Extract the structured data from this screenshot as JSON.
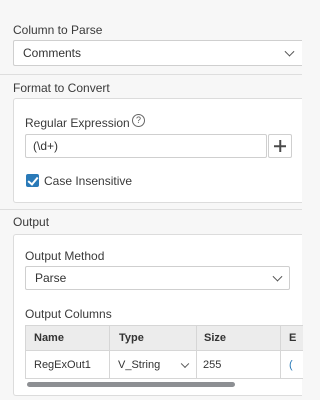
{
  "column_to_parse": {
    "label": "Column to Parse",
    "value": "Comments"
  },
  "format_to_convert": {
    "label": "Format to Convert",
    "regex_label": "Regular Expression",
    "help_glyph": "?",
    "regex_value": "(\\d+)",
    "case_insensitive_label": "Case Insensitive",
    "case_insensitive_checked": true
  },
  "output": {
    "label": "Output",
    "method_label": "Output Method",
    "method_value": "Parse",
    "columns_label": "Output Columns",
    "columns": {
      "headers": [
        "Name",
        "Type",
        "Size",
        "E"
      ],
      "rows": [
        {
          "name": "RegExOut1",
          "type": "V_String",
          "size": "255",
          "extra": "("
        }
      ]
    }
  },
  "colors": {
    "accent": "#2a7ab8",
    "background": "#f7f7f7",
    "panel": "#ffffff",
    "grid_header": "#ececec"
  }
}
